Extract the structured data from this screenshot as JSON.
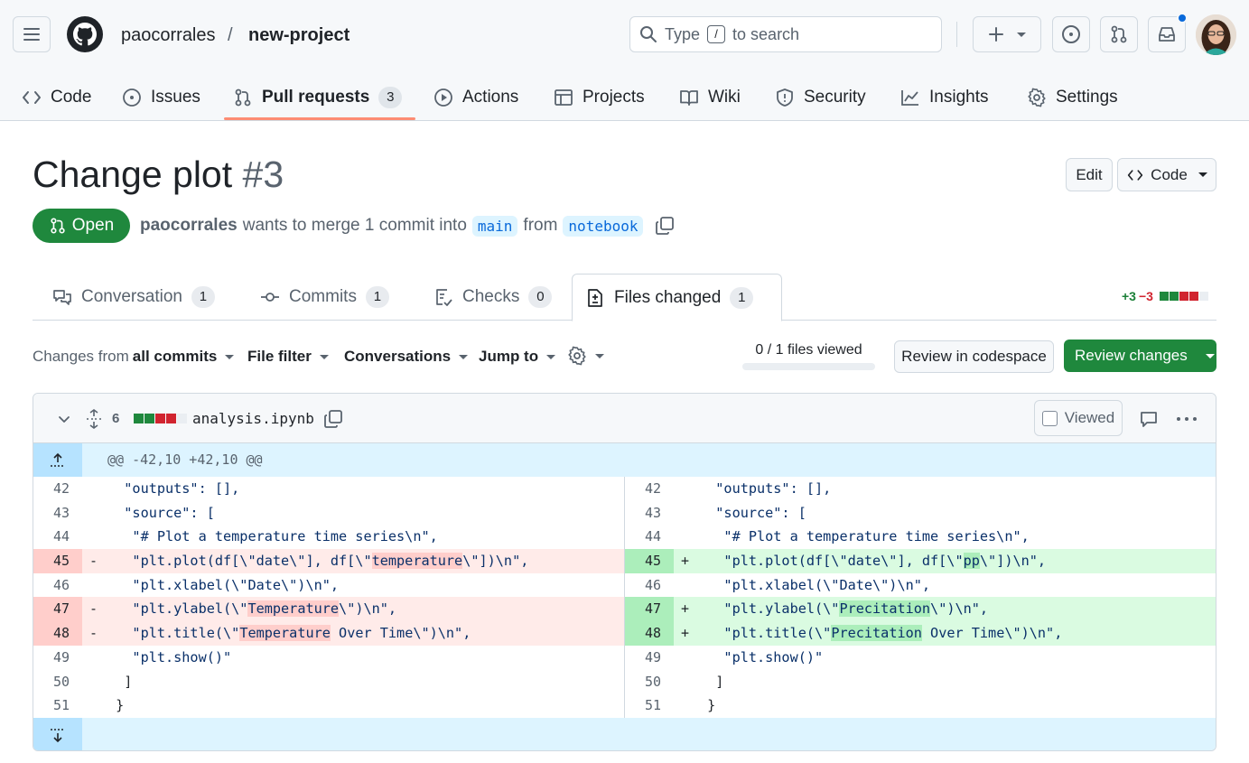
{
  "header": {
    "owner": "paocorrales",
    "separator": "/",
    "repo": "new-project",
    "search_prefix": "Type",
    "search_key": "/",
    "search_suffix": "to search"
  },
  "nav": {
    "tabs": [
      {
        "label": "Code",
        "icon": "code-icon"
      },
      {
        "label": "Issues",
        "icon": "issue-icon"
      },
      {
        "label": "Pull requests",
        "icon": "pull-request-icon",
        "count": "3"
      },
      {
        "label": "Actions",
        "icon": "play-icon"
      },
      {
        "label": "Projects",
        "icon": "table-icon"
      },
      {
        "label": "Wiki",
        "icon": "book-icon"
      },
      {
        "label": "Security",
        "icon": "shield-icon"
      },
      {
        "label": "Insights",
        "icon": "graph-icon"
      },
      {
        "label": "Settings",
        "icon": "gear-icon"
      }
    ]
  },
  "pr": {
    "title": "Change plot",
    "number": "#3",
    "edit_label": "Edit",
    "code_label": "Code",
    "state": "Open",
    "author": "paocorrales",
    "meta_text": "wants to merge 1 commit into",
    "base_branch": "main",
    "from_text": "from",
    "head_branch": "notebook"
  },
  "pr_tabs": [
    {
      "label": "Conversation",
      "count": "1",
      "icon": "comment-discussion-icon"
    },
    {
      "label": "Commits",
      "count": "1",
      "icon": "commit-icon"
    },
    {
      "label": "Checks",
      "count": "0",
      "icon": "checklist-icon"
    },
    {
      "label": "Files changed",
      "count": "1",
      "icon": "file-diff-icon"
    }
  ],
  "diffstat": {
    "additions": "+3",
    "deletions": "−3"
  },
  "toolbar": {
    "changes_prefix": "Changes from",
    "changes_value": "all commits",
    "file_filter": "File filter",
    "conversations": "Conversations",
    "jump_to": "Jump to",
    "files_viewed": "0 / 1 files viewed",
    "codespace": "Review in codespace",
    "review": "Review changes"
  },
  "file": {
    "changes": "6",
    "name": "analysis.ipynb",
    "viewed_label": "Viewed",
    "hunk": "@@ -42,10 +42,10 @@"
  },
  "colors": {
    "green": "#1f883d",
    "red": "#d1242f",
    "accent": "#0969da",
    "tab_underline": "#fd8c73"
  }
}
